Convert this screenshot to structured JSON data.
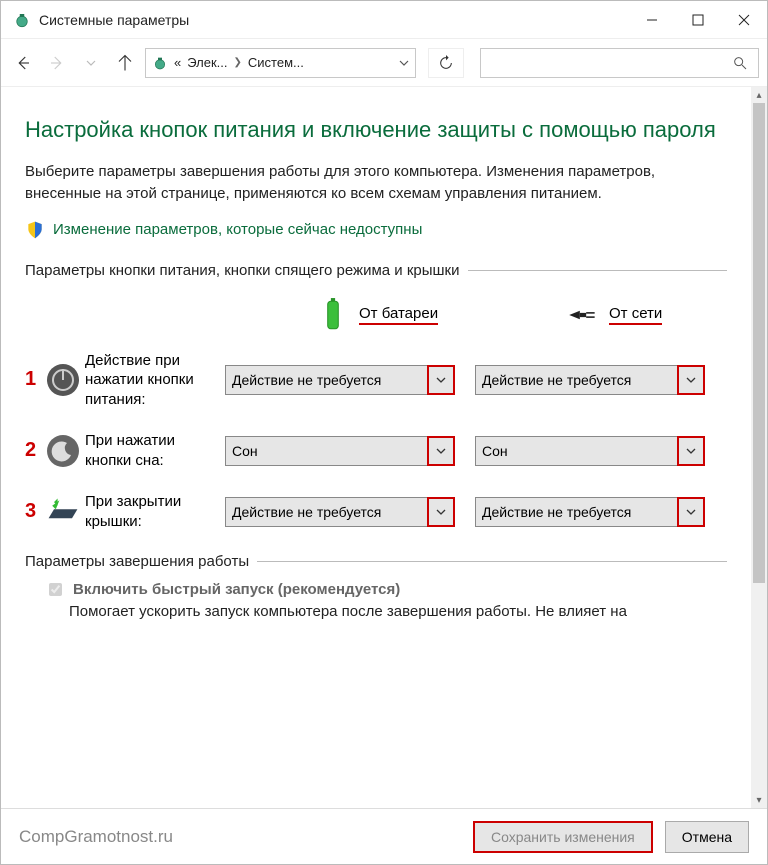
{
  "window": {
    "title": "Системные параметры"
  },
  "breadcrumb": {
    "prefix": "«",
    "item1": "Элек...",
    "item2": "Систем..."
  },
  "page": {
    "heading": "Настройка кнопок питания и включение защиты с помощью пароля",
    "description": "Выберите параметры завершения работы для этого компьютера. Изменения параметров, внесенные на этой странице, применяются ко всем схемам управления питанием.",
    "shield_link": "Изменение параметров, которые сейчас недоступны",
    "section1_title": "Параметры кнопки питания, кнопки спящего режима и крышки",
    "col_battery": "От батареи",
    "col_plugged": "От сети",
    "rows": [
      {
        "num": "1",
        "label": "Действие при нажатии кнопки питания:",
        "battery": "Действие не требуется",
        "plugged": "Действие не требуется"
      },
      {
        "num": "2",
        "label": "При нажатии кнопки сна:",
        "battery": "Сон",
        "plugged": "Сон"
      },
      {
        "num": "3",
        "label": "При закрытии крышки:",
        "battery": "Действие не требуется",
        "plugged": "Действие не требуется"
      }
    ],
    "section2_title": "Параметры завершения работы",
    "fast_startup_label": "Включить быстрый запуск (рекомендуется)",
    "fast_startup_desc": "Помогает ускорить запуск компьютера после завершения работы. Не влияет на"
  },
  "footer": {
    "watermark": "CompGramotnost.ru",
    "save": "Сохранить изменения",
    "cancel": "Отмена"
  }
}
